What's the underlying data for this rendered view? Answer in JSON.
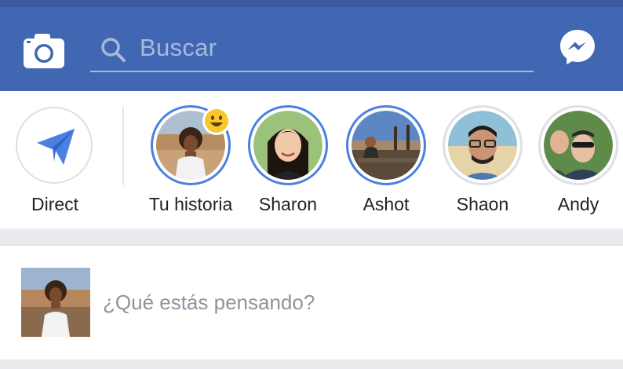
{
  "topbar": {
    "search": {
      "placeholder": "Buscar"
    },
    "icons": [
      "camera-icon",
      "search-icon",
      "messenger-icon"
    ],
    "color": "#4267b2"
  },
  "stories": {
    "direct": {
      "label": "Direct",
      "icon": "paper-plane-icon"
    },
    "items": [
      {
        "label": "Tu historia",
        "ring": "blue",
        "badge": "emoji-smile"
      },
      {
        "label": "Sharon",
        "ring": "blue"
      },
      {
        "label": "Ashot",
        "ring": "blue"
      },
      {
        "label": "Shaon",
        "ring": "grey"
      },
      {
        "label": "Andy",
        "ring": "grey"
      }
    ]
  },
  "composer": {
    "placeholder": "¿Qué estás pensando?"
  },
  "colors": {
    "accent": "#4267b2",
    "ring_active": "#4a80e0",
    "direct_blue": "#4a80e0"
  }
}
